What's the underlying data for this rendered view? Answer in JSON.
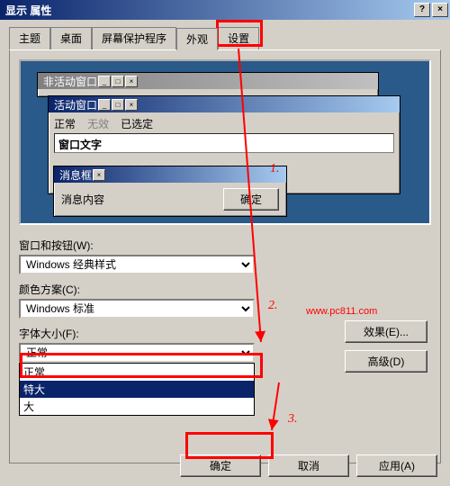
{
  "title": "显示 属性",
  "titlebar_buttons": {
    "help": "?",
    "close": "×"
  },
  "tabs": [
    "主题",
    "桌面",
    "屏幕保护程序",
    "外观",
    "设置"
  ],
  "active_tab": 3,
  "preview": {
    "inactive_title": "非活动窗口",
    "active_title": "活动窗口",
    "states": {
      "normal": "正常",
      "disabled": "无效",
      "selected": "已选定"
    },
    "textbox_label": "窗口文字",
    "msgbox_title": "消息框",
    "msgbox_text": "消息内容",
    "msgbox_ok": "确定",
    "win_buttons": {
      "min": "_",
      "max": "□",
      "close": "×"
    }
  },
  "form": {
    "style_label": "窗口和按钮(W):",
    "style_value": "Windows 经典样式",
    "scheme_label": "颜色方案(C):",
    "scheme_value": "Windows 标准",
    "size_label": "字体大小(F):",
    "size_value": "正常",
    "size_options": [
      "正常",
      "特大",
      "大"
    ],
    "effects": "效果(E)...",
    "advanced": "高级(D)"
  },
  "buttons": {
    "ok": "确定",
    "cancel": "取消",
    "apply": "应用(A)"
  },
  "annotations": {
    "n1": "1.",
    "n2": "2.",
    "n3": "3.",
    "url": "www.pc811.com"
  }
}
